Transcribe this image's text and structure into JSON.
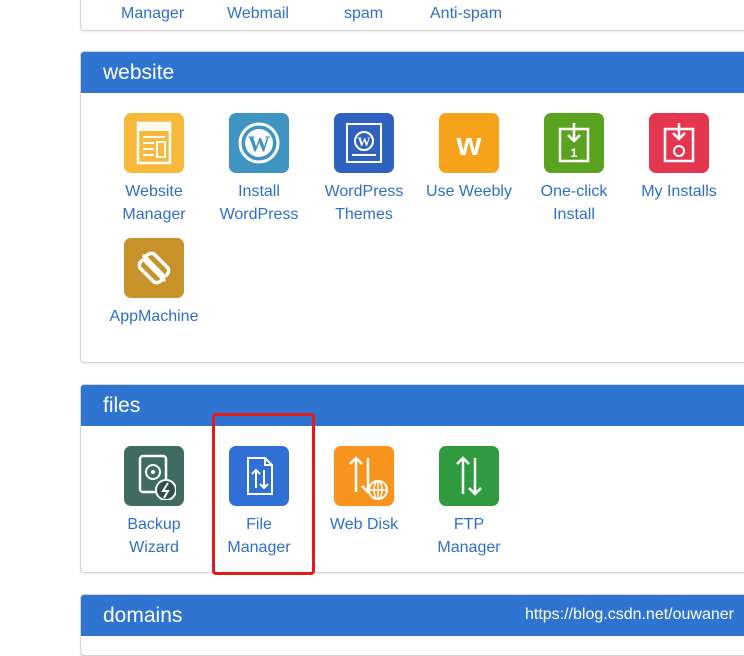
{
  "top_section": {
    "labels": [
      "Manager",
      "Webmail",
      "spam",
      "Anti-spam"
    ]
  },
  "website": {
    "title": "website",
    "items": [
      {
        "label": "Website\nManager",
        "icon": "website-manager-icon",
        "color": "#f8b93a"
      },
      {
        "label": "Install\nWordPress",
        "icon": "wordpress-icon",
        "color": "#3f94c2"
      },
      {
        "label": "WordPress\nThemes",
        "icon": "wordpress-themes-icon",
        "color": "#2f62c0"
      },
      {
        "label": "Use Weebly",
        "icon": "weebly-icon",
        "color": "#f7a21b"
      },
      {
        "label": "One-click\nInstall",
        "icon": "one-click-install-icon",
        "color": "#5aa320"
      },
      {
        "label": "My Installs",
        "icon": "my-installs-icon",
        "color": "#e5364f"
      },
      {
        "label": "AppMachine",
        "icon": "appmachine-icon",
        "color": "#c9912a"
      }
    ]
  },
  "files": {
    "title": "files",
    "items": [
      {
        "label": "Backup\nWizard",
        "icon": "backup-wizard-icon",
        "color": "#3f6b60"
      },
      {
        "label": "File\nManager",
        "icon": "file-manager-icon",
        "color": "#2f6fd6"
      },
      {
        "label": "Web Disk",
        "icon": "web-disk-icon",
        "color": "#f7941d"
      },
      {
        "label": "FTP\nManager",
        "icon": "ftp-manager-icon",
        "color": "#2f9a40"
      }
    ]
  },
  "domains": {
    "title": "domains"
  },
  "watermark": "https://blog.csdn.net/ouwaner"
}
